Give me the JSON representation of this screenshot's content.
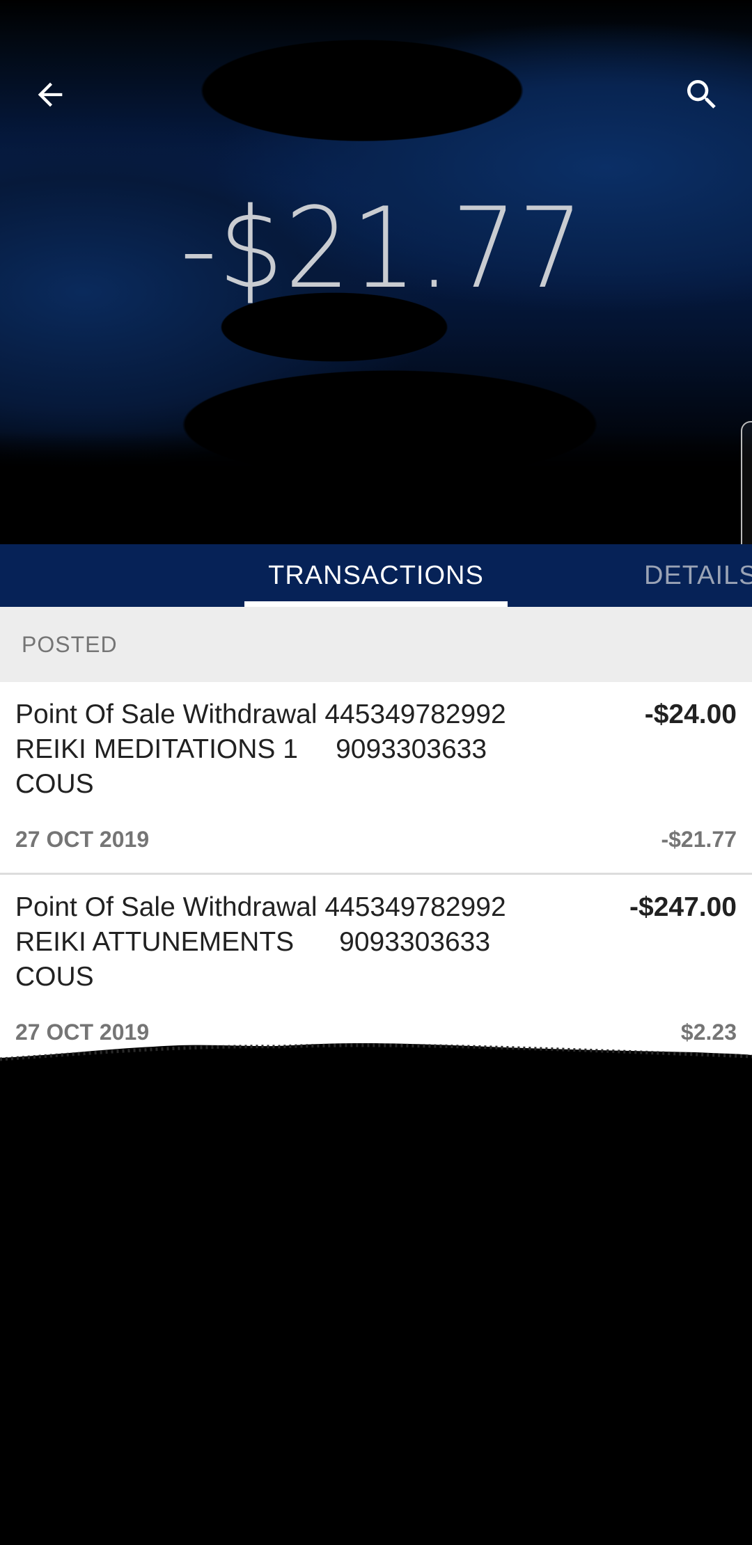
{
  "header": {
    "back_icon": "arrow-left-icon",
    "search_icon": "search-icon",
    "balance": "-$21.77"
  },
  "tabs": [
    {
      "label": "TRANSACTIONS",
      "selected": true
    },
    {
      "label": "DETAILS",
      "selected": false
    }
  ],
  "section": {
    "label": "POSTED"
  },
  "transactions": [
    {
      "description": "Point Of Sale Withdrawal 445349782992 REIKI MEDITATIONS 1     9093303633 COUS",
      "amount": "-$24.00",
      "date": "27 OCT 2019",
      "balance": "-$21.77"
    },
    {
      "description": "Point Of Sale Withdrawal 445349782992 REIKI ATTUNEMENTS      9093303633 COUS",
      "amount": "-$247.00",
      "date": "27 OCT 2019",
      "balance": "$2.23"
    }
  ],
  "colors": {
    "tab_bar": "#062257",
    "list_header_bg": "#ededed",
    "primary_text": "#212121",
    "secondary_text": "#757575"
  }
}
